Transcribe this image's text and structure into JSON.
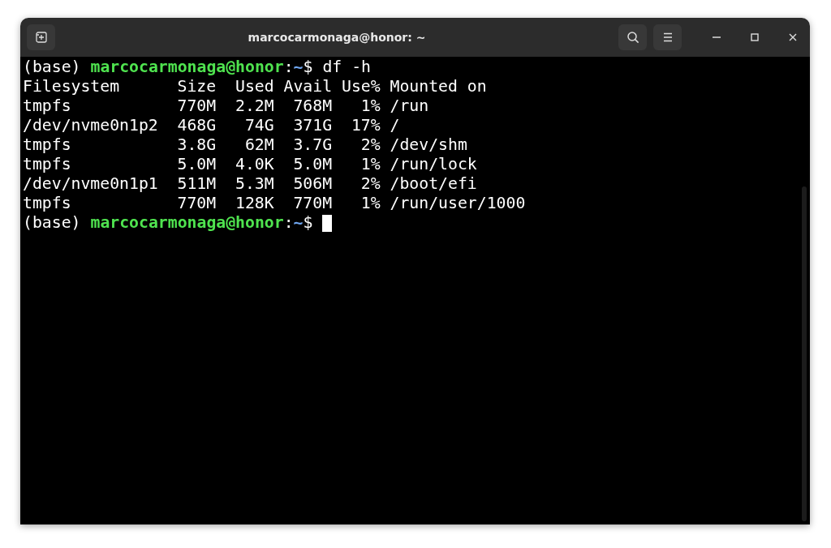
{
  "window": {
    "title": "marcocarmonaga@honor: ~"
  },
  "terminal": {
    "lines": [
      {
        "kind": "prompt",
        "env": "(base)",
        "user_host": "marcocarmonaga@honor",
        "separator": ":",
        "path": "~",
        "symbol": "$",
        "command": "df -h"
      },
      {
        "kind": "output",
        "text": "Filesystem      Size  Used Avail Use% Mounted on"
      },
      {
        "kind": "output",
        "text": "tmpfs           770M  2.2M  768M   1% /run"
      },
      {
        "kind": "output",
        "text": "/dev/nvme0n1p2  468G   74G  371G  17% /"
      },
      {
        "kind": "output",
        "text": "tmpfs           3.8G   62M  3.7G   2% /dev/shm"
      },
      {
        "kind": "output",
        "text": "tmpfs           5.0M  4.0K  5.0M   1% /run/lock"
      },
      {
        "kind": "output",
        "text": "/dev/nvme0n1p1  511M  5.3M  506M   2% /boot/efi"
      },
      {
        "kind": "output",
        "text": "tmpfs           770M  128K  770M   1% /run/user/1000"
      },
      {
        "kind": "prompt",
        "env": "(base)",
        "user_host": "marcocarmonaga@honor",
        "separator": ":",
        "path": "~",
        "symbol": "$",
        "cursor": true
      }
    ]
  }
}
